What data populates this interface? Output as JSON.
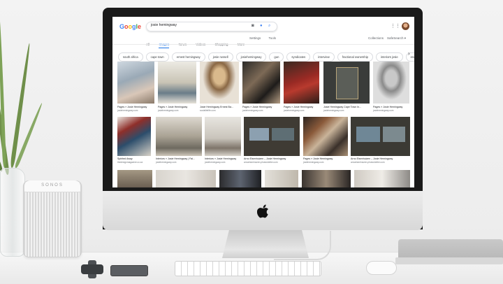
{
  "google": {
    "logo": "Google",
    "logo_colors": [
      "#4285F4",
      "#EA4335",
      "#FBBC05",
      "#4285F4",
      "#34A853",
      "#EA4335"
    ],
    "query": "josie hemingway",
    "tabs": [
      "All",
      "Images",
      "News",
      "Videos",
      "Shopping",
      "More"
    ],
    "active_tab": "Images",
    "tools": [
      "Settings",
      "Tools"
    ],
    "collections": "Collections",
    "safesearch": "SafeSearch ▾",
    "chips": [
      "south africa",
      "cape town",
      "ernest hemingway",
      "josie russell",
      "josiehemingway",
      "gun",
      "syndicates",
      "interview",
      "fractional ownership",
      "interiors josie",
      "enquire"
    ]
  },
  "results": {
    "row1": [
      {
        "caption": "Pages » Josie Hemingway",
        "source": "josiehemingway.com"
      },
      {
        "caption": "Pages » Josie Hemingway",
        "source": "josiehemingway.com"
      },
      {
        "caption": "Josie Hemingway Ernest Ba...",
        "source": "socialitelife.com"
      },
      {
        "caption": "Pages » Josie Hemingway",
        "source": "josiehemingway.com"
      },
      {
        "caption": "Pages » Josie Hemingway",
        "source": "josiehemingway.com"
      },
      {
        "caption": "Josie Hemingway Cape Town In...",
        "source": "josiehemingway.com"
      },
      {
        "caption": "Pages » Josie Hemingway",
        "source": "josiehemingway.com"
      }
    ],
    "row2": [
      {
        "caption": "Spirited Away",
        "source": "thedesignmagazine.co.za"
      },
      {
        "caption": "Interiors » Josie Hemingway | Fai...",
        "source": "josiehemingway.com"
      },
      {
        "caption": "Interiors » Josie Hemingway",
        "source": "josiehemingway.com"
      },
      {
        "caption": "Arno Eisenhuizen – Josie Hemingway",
        "source": "arnoeisenhuizen.photoshelter.com"
      },
      {
        "caption": "Pages » Josie Hemingway",
        "source": "josiehemingway.com"
      },
      {
        "caption": "Arno Eisenhuizen – Josie Hemingway",
        "source": "arnoeisenhuizen.photoshelter.com"
      }
    ]
  },
  "speaker_brand": "SONOS",
  "colors": {
    "link_blue": "#1a73e8",
    "bezel": "#1a1a1a",
    "chin": "#e3e3e3"
  }
}
